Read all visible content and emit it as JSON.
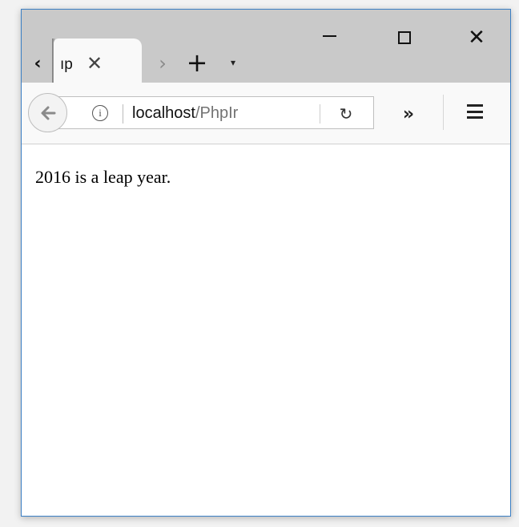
{
  "window": {
    "controls": {
      "minimize_icon": "minimize-icon",
      "maximize_icon": "maximize-icon",
      "close_glyph": "✕"
    }
  },
  "tabs": {
    "scroll_left_glyph": "‹",
    "active_tab": {
      "title": "ıp",
      "close_glyph": "✕"
    },
    "scroll_right_glyph": "›",
    "new_tab_glyph": "+",
    "list_glyph": "▾"
  },
  "navbar": {
    "back_icon": "arrow-left-icon",
    "info_glyph": "i",
    "url": {
      "host": "localhost",
      "path": "/PhpIr"
    },
    "reload_glyph": "↻",
    "overflow_glyph": "»",
    "menu_icon": "hamburger-menu-icon"
  },
  "page": {
    "text": "2016 is a leap year."
  },
  "colors": {
    "titlebar": "#c9c9c9",
    "window_border": "#3b7fc4",
    "toolbar": "#f9f9f9"
  }
}
